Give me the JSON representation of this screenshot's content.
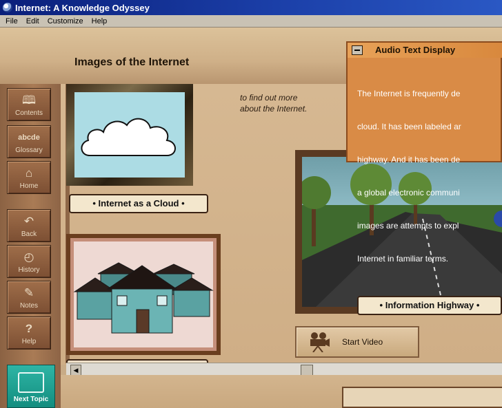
{
  "window": {
    "title": "Internet: A Knowledge Odyssey"
  },
  "menu": [
    "File",
    "Edit",
    "Customize",
    "Help"
  ],
  "page": {
    "title": "Images of the Internet"
  },
  "toolbar": {
    "contents": "Contents",
    "glossary": "Glossary",
    "glossary_glyph": "abcde",
    "home": "Home",
    "back": "Back",
    "history": "History",
    "notes": "Notes",
    "help": "Help",
    "next_topic": "Next Topic"
  },
  "main": {
    "find_out_text_1": "to find out more",
    "find_out_text_2": "about the Internet.",
    "cloud_label": "• Internet as a Cloud •",
    "highway_label": "• Information Highway •",
    "start_video": "Start Video"
  },
  "audio_panel": {
    "title": "Audio Text Display",
    "lines": [
      "The Internet is frequently de",
      "cloud. It has been labeled ar",
      "highway. And it has been de",
      "a global electronic communi",
      "images are attempts to expl",
      "Internet in familiar terms."
    ]
  }
}
